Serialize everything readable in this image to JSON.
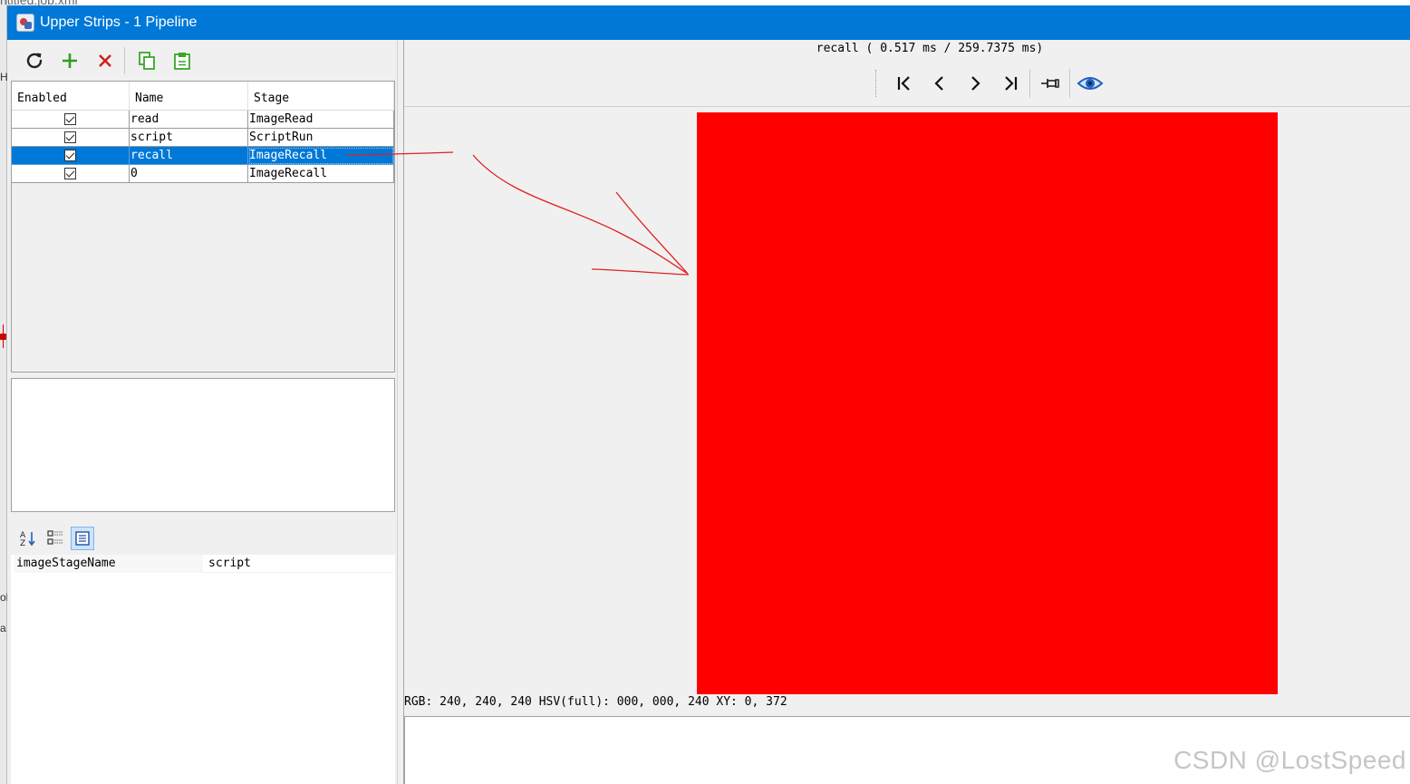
{
  "background": {
    "window_title_fragment": "ntitled.job.xml",
    "edge_marks": [
      "H",
      "ol",
      "a"
    ]
  },
  "window": {
    "title": "Upper Strips - 1 Pipeline",
    "titlebar_color": "#0078d7"
  },
  "toolbar": {
    "buttons": [
      "refresh-icon",
      "add-icon",
      "delete-icon",
      "copy-icon",
      "paste-icon"
    ]
  },
  "pipeline": {
    "columns": [
      "Enabled",
      "Name",
      "Stage"
    ],
    "rows": [
      {
        "enabled": true,
        "name": "read",
        "stage": "ImageRead"
      },
      {
        "enabled": true,
        "name": "script",
        "stage": "ScriptRun"
      },
      {
        "enabled": true,
        "name": "recall",
        "stage": "ImageRecall",
        "selected": true
      },
      {
        "enabled": true,
        "name": "0",
        "stage": "ImageRecall"
      }
    ]
  },
  "properties": {
    "toolbar": [
      "sort-alpha-icon",
      "categorized-icon",
      "property-pages-icon"
    ],
    "rows": [
      {
        "key": "imageStageName",
        "value": "script"
      }
    ]
  },
  "viewer": {
    "title": "recall ( 0.517 ms / 259.7375 ms)",
    "nav_buttons": [
      "first-frame-icon",
      "prev-frame-icon",
      "next-frame-icon",
      "last-frame-icon",
      "pin-icon",
      "eye-icon"
    ],
    "image_color": "#ff0000",
    "status": "RGB: 240, 240, 240 HSV(full): 000, 000, 240 XY: 0, 372"
  },
  "annotation_color": "#e02020",
  "watermark": "CSDN @LostSpeed"
}
